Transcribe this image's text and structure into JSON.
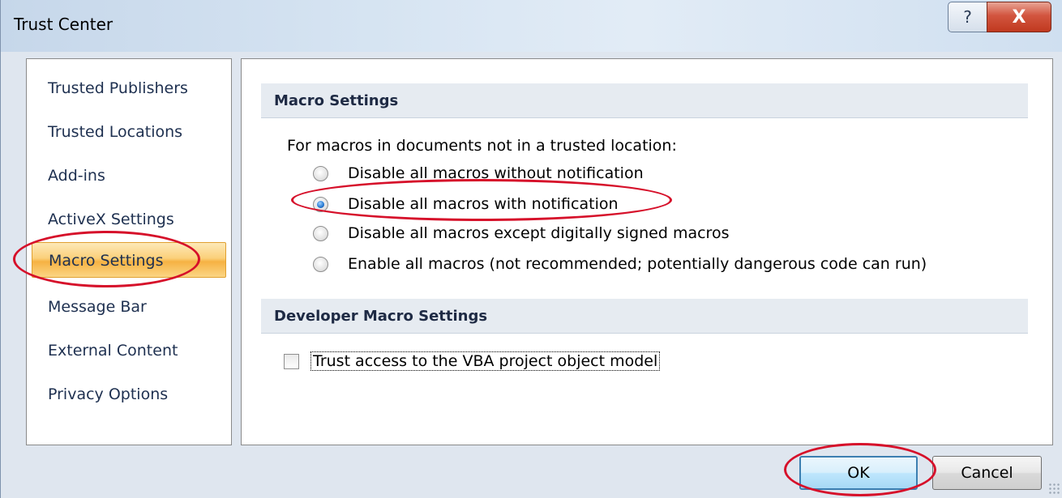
{
  "window": {
    "title": "Trust Center",
    "help_glyph": "?",
    "close_glyph": "X"
  },
  "sidebar": {
    "items": [
      {
        "label": "Trusted Publishers",
        "selected": false
      },
      {
        "label": "Trusted Locations",
        "selected": false
      },
      {
        "label": "Add-ins",
        "selected": false
      },
      {
        "label": "ActiveX Settings",
        "selected": false
      },
      {
        "label": "Macro Settings",
        "selected": true
      },
      {
        "label": "Message Bar",
        "selected": false
      },
      {
        "label": "External Content",
        "selected": false
      },
      {
        "label": "Privacy Options",
        "selected": false
      }
    ]
  },
  "macro_settings": {
    "header": "Macro Settings",
    "prompt": "For macros in documents not in a trusted location:",
    "options": [
      {
        "label": "Disable all macros without notification",
        "checked": false
      },
      {
        "label": "Disable all macros with notification",
        "checked": true
      },
      {
        "label": "Disable all macros except digitally signed macros",
        "checked": false
      },
      {
        "label": "Enable all macros (not recommended; potentially dangerous code can run)",
        "checked": false
      }
    ]
  },
  "developer_settings": {
    "header": "Developer Macro Settings",
    "checkbox_label": "Trust access to the VBA project object model",
    "checked": false
  },
  "footer": {
    "ok_label": "OK",
    "cancel_label": "Cancel"
  },
  "colors": {
    "annotation": "#d6102a",
    "selected_nav": "#f6b243",
    "nav_text": "#1e3050"
  }
}
